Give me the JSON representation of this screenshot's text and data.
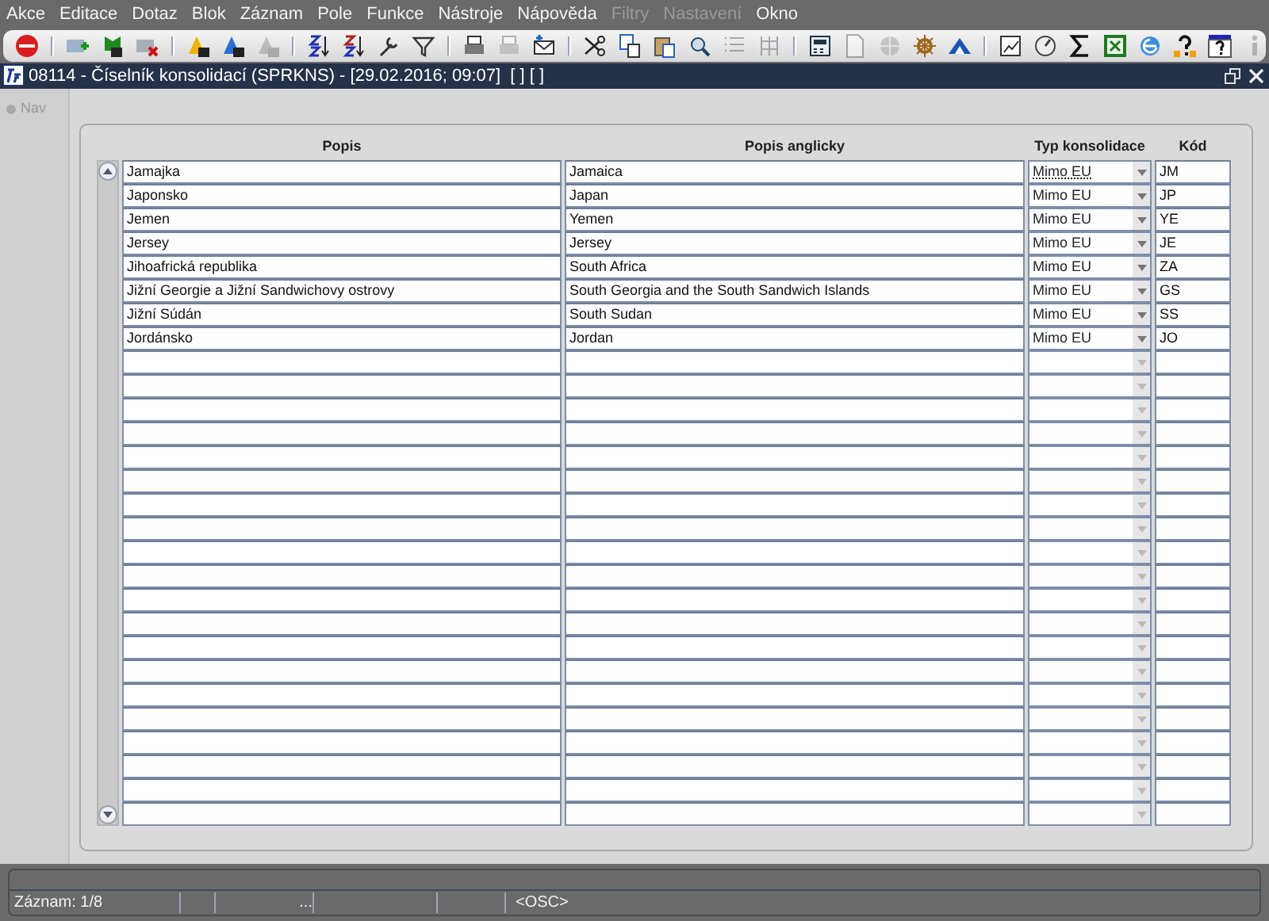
{
  "menu": [
    {
      "label": "Akce",
      "disabled": false
    },
    {
      "label": "Editace",
      "disabled": false
    },
    {
      "label": "Dotaz",
      "disabled": false
    },
    {
      "label": "Blok",
      "disabled": false
    },
    {
      "label": "Záznam",
      "disabled": false
    },
    {
      "label": "Pole",
      "disabled": false
    },
    {
      "label": "Funkce",
      "disabled": false
    },
    {
      "label": "Nástroje",
      "disabled": false
    },
    {
      "label": "Nápověda",
      "disabled": false
    },
    {
      "label": "Filtry",
      "disabled": true
    },
    {
      "label": "Nastavení",
      "disabled": true
    },
    {
      "label": "Okno",
      "disabled": false
    }
  ],
  "toolbar": [
    {
      "kind": "exit",
      "disabled": false
    },
    {
      "kind": "sep"
    },
    {
      "kind": "add",
      "disabled": false
    },
    {
      "kind": "insert",
      "disabled": false
    },
    {
      "kind": "remove",
      "disabled": false
    },
    {
      "kind": "sep"
    },
    {
      "kind": "query",
      "disabled": false
    },
    {
      "kind": "execute",
      "disabled": false
    },
    {
      "kind": "cancel",
      "disabled": true
    },
    {
      "kind": "sep"
    },
    {
      "kind": "sortup",
      "disabled": false
    },
    {
      "kind": "sortdown",
      "disabled": false
    },
    {
      "kind": "wrench",
      "disabled": false
    },
    {
      "kind": "filter",
      "disabled": false
    },
    {
      "kind": "sep"
    },
    {
      "kind": "print",
      "disabled": false
    },
    {
      "kind": "printer",
      "disabled": true
    },
    {
      "kind": "mail",
      "disabled": false
    },
    {
      "kind": "sep"
    },
    {
      "kind": "cut",
      "disabled": false
    },
    {
      "kind": "copy",
      "disabled": false
    },
    {
      "kind": "paste",
      "disabled": false
    },
    {
      "kind": "search",
      "disabled": false
    },
    {
      "kind": "list",
      "disabled": true
    },
    {
      "kind": "columns",
      "disabled": true
    },
    {
      "kind": "sep"
    },
    {
      "kind": "calc",
      "disabled": false
    },
    {
      "kind": "page",
      "disabled": true
    },
    {
      "kind": "globe",
      "disabled": true
    },
    {
      "kind": "wheel",
      "disabled": false
    },
    {
      "kind": "pyramid",
      "disabled": false
    },
    {
      "kind": "sep"
    },
    {
      "kind": "chart",
      "disabled": false
    },
    {
      "kind": "gauge",
      "disabled": false
    },
    {
      "kind": "sigma",
      "disabled": false
    },
    {
      "kind": "sheet",
      "disabled": false
    },
    {
      "kind": "browser",
      "disabled": false
    },
    {
      "kind": "help",
      "disabled": false
    },
    {
      "kind": "help2",
      "disabled": false
    },
    {
      "kind": "info",
      "disabled": true
    }
  ],
  "window": {
    "title": "08114 - Číselník konsolidací (SPRKNS) - [29.02.2016; 09:07]  [ ] [ ]"
  },
  "nav": {
    "label": "Nav"
  },
  "table": {
    "columns": [
      "Popis",
      "Popis anglicky",
      "Typ konsolidace",
      "Kód"
    ],
    "rows": [
      {
        "kind": "record",
        "popis": "Jamajka",
        "popis_anglicky": "Jamaica",
        "typ": "Mimo EU",
        "kod": "JM",
        "current": true
      },
      {
        "kind": "record",
        "popis": "Japonsko",
        "popis_anglicky": "Japan",
        "typ": "Mimo EU",
        "kod": "JP",
        "current": false
      },
      {
        "kind": "record",
        "popis": "Jemen",
        "popis_anglicky": "Yemen",
        "typ": "Mimo EU",
        "kod": "YE",
        "current": false
      },
      {
        "kind": "record",
        "popis": "Jersey",
        "popis_anglicky": "Jersey",
        "typ": "Mimo EU",
        "kod": "JE",
        "current": false
      },
      {
        "kind": "record",
        "popis": "Jihoafrická republika",
        "popis_anglicky": "South Africa",
        "typ": "Mimo EU",
        "kod": "ZA",
        "current": false
      },
      {
        "kind": "record",
        "popis": "Jižní Georgie a Jižní Sandwichovy ostrovy",
        "popis_anglicky": "South Georgia and the South Sandwich Islands",
        "typ": "Mimo EU",
        "kod": "GS",
        "current": false
      },
      {
        "kind": "record",
        "popis": "Jižní Súdán",
        "popis_anglicky": "South Sudan",
        "typ": "Mimo EU",
        "kod": "SS",
        "current": false
      },
      {
        "kind": "record",
        "popis": "Jordánsko",
        "popis_anglicky": "Jordan",
        "typ": "Mimo EU",
        "kod": "JO",
        "current": false
      },
      {
        "kind": "blank"
      },
      {
        "kind": "blank"
      },
      {
        "kind": "blank"
      },
      {
        "kind": "blank"
      },
      {
        "kind": "blank"
      },
      {
        "kind": "blank"
      },
      {
        "kind": "blank"
      },
      {
        "kind": "blank"
      },
      {
        "kind": "blank"
      },
      {
        "kind": "blank"
      },
      {
        "kind": "blank"
      },
      {
        "kind": "blank"
      },
      {
        "kind": "blank"
      },
      {
        "kind": "blank"
      },
      {
        "kind": "blank"
      },
      {
        "kind": "blank"
      },
      {
        "kind": "blank"
      },
      {
        "kind": "blank"
      },
      {
        "kind": "blank"
      },
      {
        "kind": "blank"
      }
    ]
  },
  "status_bar": {
    "record": "Záznam: 1/8",
    "ellipsis": "...",
    "mode": "<OSC>"
  }
}
